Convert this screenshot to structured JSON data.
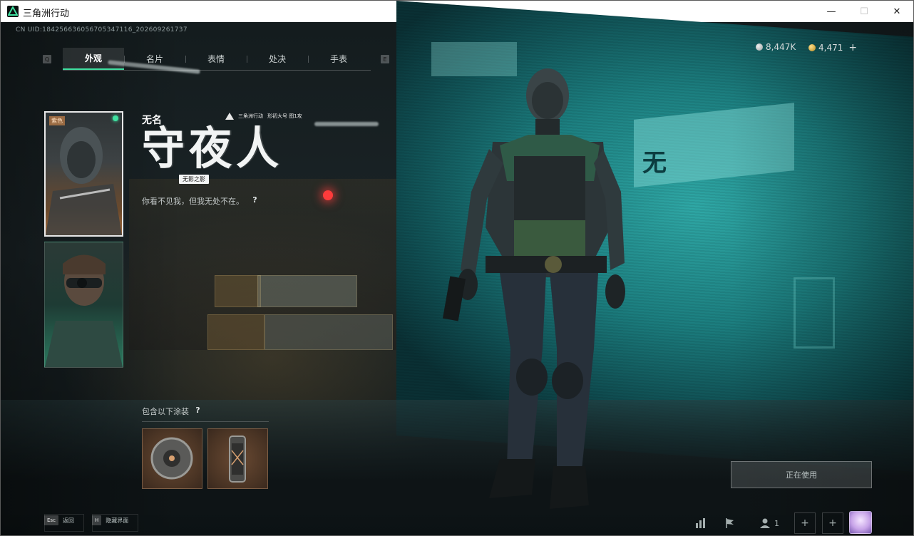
{
  "window": {
    "title": "三角洲行动",
    "minimize_glyph": "—",
    "maximize_glyph": "☐",
    "close_glyph": "✕"
  },
  "scene": {
    "screen_text": "无"
  },
  "header": {
    "uid": "CN UID:184256636056705347116_202609261737",
    "key_prev": "Q",
    "key_next": "E"
  },
  "tabs": [
    {
      "label": "外观",
      "active": true
    },
    {
      "label": "名片",
      "active": false
    },
    {
      "label": "表情",
      "active": false
    },
    {
      "label": "处决",
      "active": false
    },
    {
      "label": "手表",
      "active": false
    }
  ],
  "currency": [
    {
      "icon": "silver-coin-icon",
      "value": "8,447K"
    },
    {
      "icon": "gold-coin-icon",
      "value": "4,471"
    }
  ],
  "currency_add_label": "+",
  "cards": [
    {
      "tag": "紫色",
      "selected": true
    },
    {
      "tag": "",
      "selected": false
    }
  ],
  "skin": {
    "name_small": "无名",
    "name_big": "守夜人",
    "subtitle": "无影之影",
    "brand": "三角洲行动",
    "brand_extra": "形初大号 图1攻",
    "quote": "你看不见我，但我无处不在。",
    "help": "?"
  },
  "includes": {
    "label": "包含以下涂装",
    "help": "?",
    "items": [
      {
        "name": "grenade-icon"
      },
      {
        "name": "canister-icon"
      }
    ]
  },
  "in_use_label": "正在使用",
  "bottom": {
    "esc_key": "Esc",
    "esc_label": "返回",
    "hide_key": "H",
    "hide_label": "隐藏界面",
    "friends_count": "1",
    "add_label": "+"
  },
  "colors": {
    "accent": "#3fe0a0",
    "screen_teal": "#1c7f80"
  }
}
